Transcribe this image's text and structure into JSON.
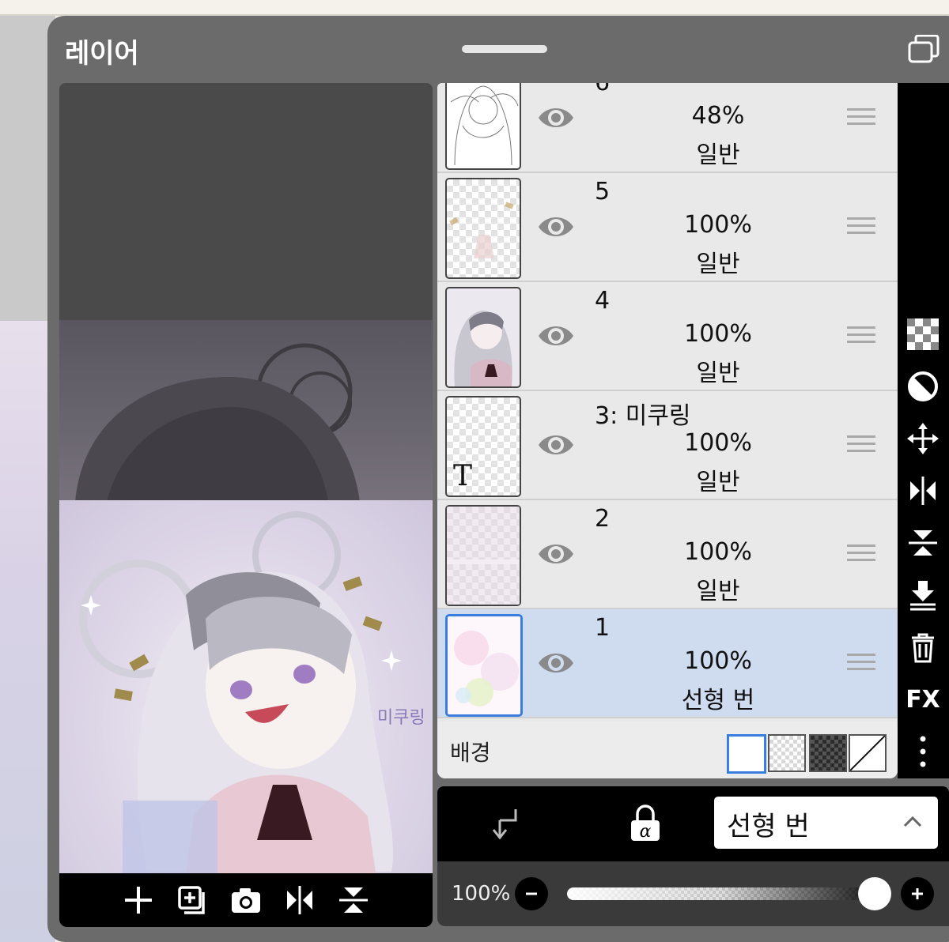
{
  "panel": {
    "title": "레이어"
  },
  "layers": [
    {
      "name": "6",
      "opacity": "48%",
      "blend": "일반",
      "selected": false,
      "thumb": "sketch"
    },
    {
      "name": "5",
      "opacity": "100%",
      "blend": "일반",
      "selected": false,
      "thumb": "checker"
    },
    {
      "name": "4",
      "opacity": "100%",
      "blend": "일반",
      "selected": false,
      "thumb": "art"
    },
    {
      "name": "3: 미쿠링",
      "opacity": "100%",
      "blend": "일반",
      "selected": false,
      "thumb": "text"
    },
    {
      "name": "2",
      "opacity": "100%",
      "blend": "일반",
      "selected": false,
      "thumb": "checker"
    },
    {
      "name": "1",
      "opacity": "100%",
      "blend": "선형 번",
      "selected": true,
      "thumb": "light"
    }
  ],
  "background": {
    "label": "배경"
  },
  "controls": {
    "blend_mode": "선형 번"
  },
  "opacity": {
    "label": "100%",
    "value_percent": 100,
    "minus": "−",
    "plus": "+"
  },
  "tools": {
    "fx": "FX"
  },
  "thumb_text": {
    "glyph": "T"
  },
  "preview": {
    "watermark": "미쿠링"
  }
}
